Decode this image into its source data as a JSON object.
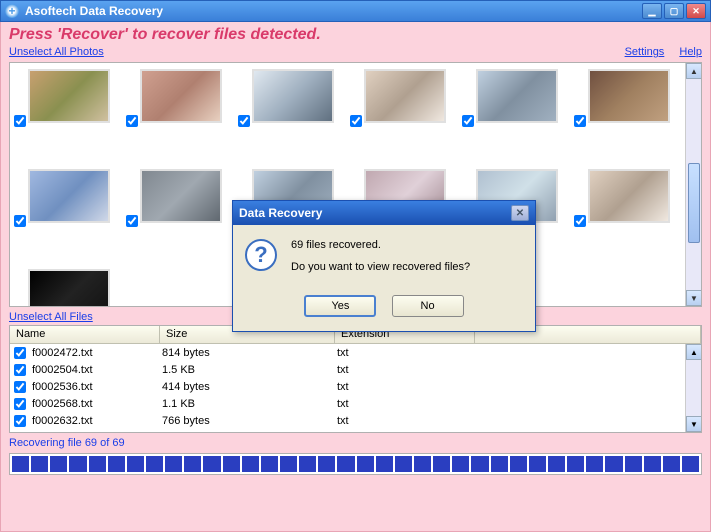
{
  "titlebar": {
    "app_name": "Asoftech Data Recovery"
  },
  "instruction": "Press 'Recover' to recover files detected.",
  "links": {
    "unselect_photos": "Unselect All Photos",
    "unselect_files": "Unselect All Files",
    "settings": "Settings",
    "help": "Help"
  },
  "file_table": {
    "headers": {
      "name": "Name",
      "size": "Size",
      "ext": "Extension"
    },
    "rows": [
      {
        "name": "f0002472.txt",
        "size": "814 bytes",
        "ext": "txt"
      },
      {
        "name": "f0002504.txt",
        "size": "1.5 KB",
        "ext": "txt"
      },
      {
        "name": "f0002536.txt",
        "size": "414 bytes",
        "ext": "txt"
      },
      {
        "name": "f0002568.txt",
        "size": "1.1 KB",
        "ext": "txt"
      },
      {
        "name": "f0002632.txt",
        "size": "766 bytes",
        "ext": "txt"
      }
    ]
  },
  "progress": {
    "label": "Recovering file 69 of 69",
    "segments": 36
  },
  "dialog": {
    "title": "Data Recovery",
    "line1": "69 files recovered.",
    "line2": "Do you want to view recovered files?",
    "yes": "Yes",
    "no": "No"
  }
}
